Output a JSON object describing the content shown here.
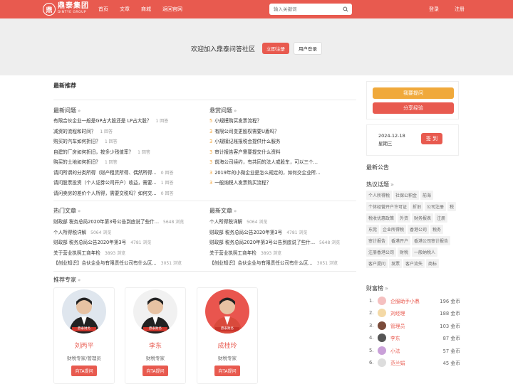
{
  "header": {
    "logo_mark": "鼎",
    "logo_cn": "鼎泰集团",
    "logo_en": "DINTYE GROUP",
    "nav": [
      "首页",
      "文章",
      "商城",
      "返回官网"
    ],
    "search_placeholder": "输入关键词",
    "login": "登录",
    "register": "注册"
  },
  "banner": {
    "text": "欢迎加入鼎泰问答社区",
    "register_btn": "立即注册",
    "login_btn": "用户登录"
  },
  "main": {
    "latest_recommend": "最新推荐",
    "latest_questions": {
      "title": "最新问题",
      "arrow": "»",
      "items": [
        {
          "text": "有限合伙企业一般是GP占大股还是 LP占大股？",
          "meta": "1 回答"
        },
        {
          "text": "减资的流程和时间？",
          "meta": "1 回答"
        },
        {
          "text": "购买的汽车如何折旧？",
          "meta": "1 回答"
        },
        {
          "text": "自建的厂房如何折旧，按多少残值率？",
          "meta": "1 回答"
        },
        {
          "text": "购买的土地如何折旧？",
          "meta": "1 回答"
        },
        {
          "text": "请问所谓的分类所得（财产租赁所得、偶然所得...",
          "meta": "0 回答"
        },
        {
          "text": "请问股票投资（个人证券公司开户）收益，需要...",
          "meta": "1 回答"
        },
        {
          "text": "请问卖房的差价个人所得，需要交税吗？如何交...",
          "meta": "0 回答"
        }
      ]
    },
    "reward_questions": {
      "title": "悬赏问题",
      "arrow": "»",
      "items": [
        {
          "num": "5",
          "text": "小规模购买发票流程？"
        },
        {
          "num": "3",
          "text": "有限公司变更股权需要U盾吗？"
        },
        {
          "num": "3",
          "text": "小规模记账报税会提供什么服务"
        },
        {
          "num": "3",
          "text": "审计报告客户需要提交什么资料"
        },
        {
          "num": "3",
          "text": "前海公司续约，有共同的法人或股东，可以三个..."
        },
        {
          "num": "3",
          "text": "2019年的小微企业是怎么规定的，如何交企业所..."
        },
        {
          "num": "3",
          "text": "一般纳税人发票购买流程？"
        }
      ]
    },
    "hot_articles": {
      "title": "热门文章",
      "arrow": "»",
      "items": [
        {
          "text": "财政部 税务总局2020年第3号公告到底说了些什...",
          "meta": "5648 浏览"
        },
        {
          "text": "个人所得税详解",
          "meta": "5064 浏览"
        },
        {
          "text": "财政部 税务总局公告2020年第3号",
          "meta": "4781 浏览"
        },
        {
          "text": "关于营业执照工商年检",
          "meta": "3893 浏览"
        },
        {
          "text": "【创业知识】合伙企业与有限责任公司有什么区...",
          "meta": "3051 浏览"
        }
      ]
    },
    "latest_articles": {
      "title": "最新文章",
      "arrow": "»",
      "items": [
        {
          "text": "个人所得税详解",
          "meta": "5064 浏览"
        },
        {
          "text": "财政部 税务总局公告2020年第3号",
          "meta": "4781 浏览"
        },
        {
          "text": "财政部 税务总局2020年第3号公告到底说了些什...",
          "meta": "5648 浏览"
        },
        {
          "text": "关于营业执照工商年检",
          "meta": "3893 浏览"
        },
        {
          "text": "【创业知识】合伙企业与有限责任公司有什么区...",
          "meta": "3051 浏览"
        }
      ]
    },
    "experts": {
      "title": "推荐专家",
      "arrow": "»",
      "items": [
        {
          "name": "刘丙平",
          "title": "财税专家/管理员",
          "btn": "向TA提问",
          "bg": "#dfe6ee"
        },
        {
          "name": "李东",
          "title": "财税专家",
          "btn": "向TA提问",
          "bg": "#f1f1f1"
        },
        {
          "name": "成桂玲",
          "title": "财税专家",
          "btn": "向TA提问",
          "bg": "#e9554e"
        }
      ],
      "badge": "鼎泰财务"
    }
  },
  "sidebar": {
    "ask_btn": "我要提问",
    "share_btn": "分享经验",
    "ask_color": "#f0a93b",
    "share_color": "#e85a4f",
    "date": "2024-12-18",
    "weekday": "星期三",
    "checkin_btn": "签 到",
    "latest_notice": "最新公告",
    "hot_topics": "热议话题",
    "hot_topics_arrow": "»",
    "tags": [
      "个人所得税",
      "社保公积金",
      "前海",
      "个体经营开户许可证",
      "折旧",
      "公司注册",
      "税",
      "税收优惠政策",
      "外资",
      "财务报表",
      "注册",
      "东莞",
      "企业所得税",
      "香港公司",
      "税务",
      "审计报告",
      "香港开户",
      "香港公司审计报告",
      "注册香港公司",
      "财税",
      "一般纳税人",
      "客户提问",
      "发票",
      "客户流失",
      "商标"
    ],
    "wealth_rank": "财富榜",
    "wealth_arrow": "»",
    "rank": [
      {
        "idx": "1.",
        "name": "企服助手小鼎",
        "value": "196 金币",
        "color": "#f5c0c0"
      },
      {
        "idx": "2.",
        "name": "刘经理",
        "value": "188 金币",
        "color": "#f4d9a6"
      },
      {
        "idx": "3.",
        "name": "管理员",
        "value": "103 金币",
        "color": "#7a4b3a"
      },
      {
        "idx": "4.",
        "name": "李东",
        "value": "87 金币",
        "color": "#555"
      },
      {
        "idx": "5.",
        "name": "小法",
        "value": "57 金币",
        "color": "#c9a0d8"
      },
      {
        "idx": "6.",
        "name": "范兰娟",
        "value": "45 金币",
        "color": "#ddd"
      }
    ]
  }
}
